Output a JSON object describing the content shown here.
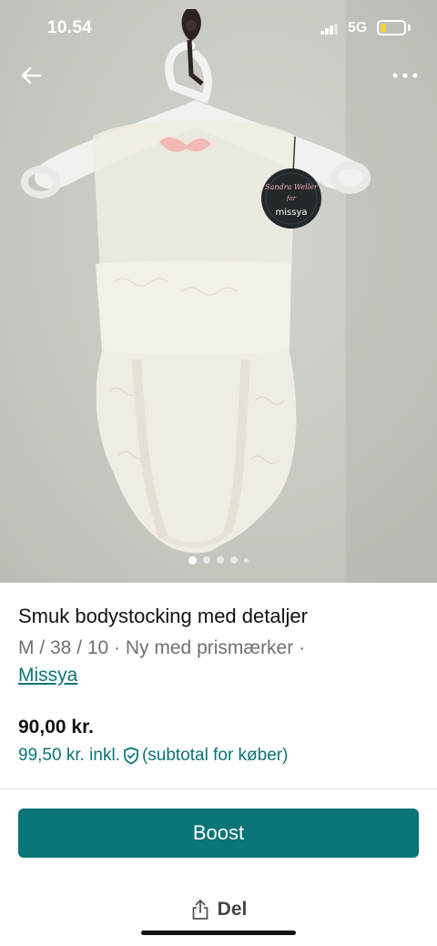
{
  "status_bar": {
    "time": "10.54",
    "network": "5G",
    "battery_level": 0.25,
    "battery_color": "#f4d23a"
  },
  "nav": {
    "back_icon": "arrow-left-icon",
    "more_icon": "ellipsis-icon"
  },
  "gallery": {
    "image_count": 5,
    "active_index": 0
  },
  "product": {
    "title": "Smuk bodystocking med detaljer",
    "meta": "M / 38 / 10 · Ny med prismærker ·",
    "brand": "Missya",
    "price": "90,00 kr.",
    "buyer_price_amount": "99,50 kr. inkl.",
    "buyer_price_note": "(subtotal for køber)",
    "buyer_protection_icon": "shield-check-icon"
  },
  "actions": {
    "boost_label": "Boost",
    "share_label": "Del",
    "share_icon": "share-icon"
  },
  "photo_tag": {
    "brand_script": "Sandra Weller",
    "for_text": "for",
    "logo_text": "missya"
  },
  "colors": {
    "accent": "#0b7476",
    "meta_text": "#707070"
  }
}
